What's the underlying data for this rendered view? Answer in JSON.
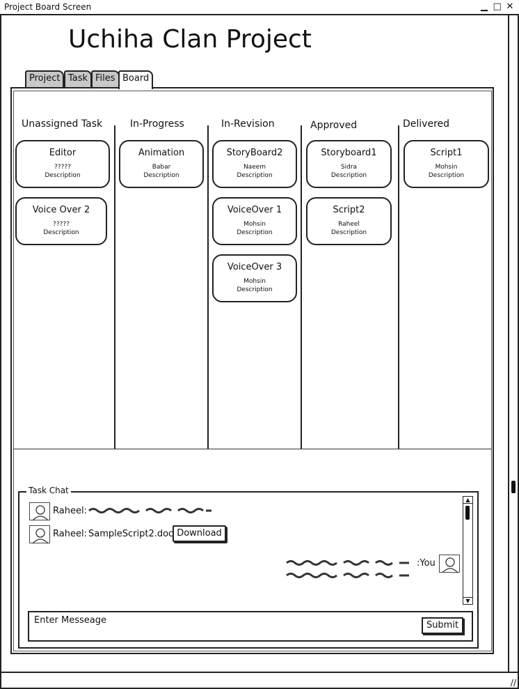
{
  "window": {
    "title": "Project Board Screen",
    "controls": {
      "minimize": "▁",
      "maximize": "□",
      "close": "✕"
    }
  },
  "project": {
    "title": "Uchiha Clan Project"
  },
  "tabs": [
    {
      "label": "Project"
    },
    {
      "label": "Task"
    },
    {
      "label": "Files"
    },
    {
      "label": "Board"
    }
  ],
  "board": {
    "columns": [
      {
        "title": "Unassigned Task",
        "cards": [
          {
            "title": "Editor",
            "assignee": "?????",
            "desc": "Description"
          },
          {
            "title": "Voice Over 2",
            "assignee": "?????",
            "desc": "Description"
          }
        ]
      },
      {
        "title": "In-Progress",
        "cards": [
          {
            "title": "Animation",
            "assignee": "Babar",
            "desc": "Description"
          }
        ]
      },
      {
        "title": "In-Revision",
        "cards": [
          {
            "title": "StoryBoard2",
            "assignee": "Naeem",
            "desc": "Description"
          },
          {
            "title": "VoiceOver 1",
            "assignee": "Mohsin",
            "desc": "Description"
          },
          {
            "title": "VoiceOver 3",
            "assignee": "Mohsin",
            "desc": "Description"
          }
        ]
      },
      {
        "title": "Approved",
        "cards": [
          {
            "title": "Storyboard1",
            "assignee": "Sidra",
            "desc": "Description"
          },
          {
            "title": "Script2",
            "assignee": "Raheel",
            "desc": "Description"
          }
        ]
      },
      {
        "title": "Delivered",
        "cards": [
          {
            "title": "Script1",
            "assignee": "Mohsin",
            "desc": "Description"
          }
        ]
      }
    ]
  },
  "chat": {
    "label": "Task Chat",
    "messages": [
      {
        "sender": "Raheel:"
      },
      {
        "sender": "Raheel:",
        "file": "SampleScript2.doc",
        "button": "Download"
      },
      {
        "sender": ":You"
      }
    ],
    "input_placeholder": "Enter Messeage",
    "submit_label": "Submit"
  }
}
